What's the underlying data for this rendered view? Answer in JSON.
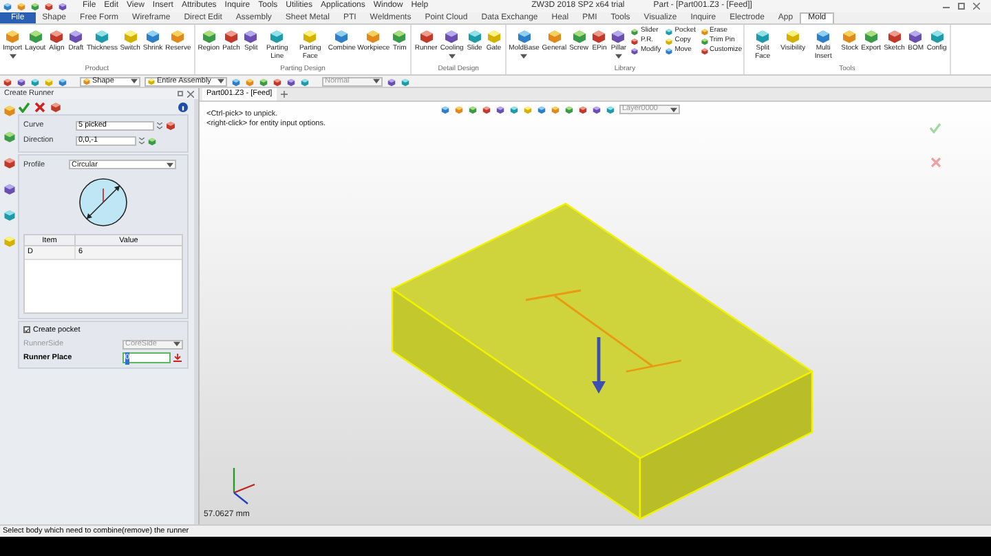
{
  "title_bar": {
    "menu": [
      "File",
      "Edit",
      "View",
      "Insert",
      "Attributes",
      "Inquire",
      "Tools",
      "Utilities",
      "Applications",
      "Window",
      "Help"
    ],
    "app_title": "ZW3D 2018 SP2 x64 trial",
    "document_title": "Part - [Part001.Z3 - [Feed]]"
  },
  "ribbon_tabs": [
    {
      "label": "File",
      "kind": "file",
      "selected": false
    },
    {
      "label": "Shape",
      "kind": "tab",
      "selected": false
    },
    {
      "label": "Free Form",
      "kind": "tab",
      "selected": false
    },
    {
      "label": "Wireframe",
      "kind": "tab",
      "selected": false
    },
    {
      "label": "Direct Edit",
      "kind": "tab",
      "selected": false
    },
    {
      "label": "Assembly",
      "kind": "tab",
      "selected": false
    },
    {
      "label": "Sheet Metal",
      "kind": "tab",
      "selected": false
    },
    {
      "label": "PTI",
      "kind": "tab",
      "selected": false
    },
    {
      "label": "Weldments",
      "kind": "tab",
      "selected": false
    },
    {
      "label": "Point Cloud",
      "kind": "tab",
      "selected": false
    },
    {
      "label": "Data Exchange",
      "kind": "tab",
      "selected": false
    },
    {
      "label": "Heal",
      "kind": "tab",
      "selected": false
    },
    {
      "label": "PMI",
      "kind": "tab",
      "selected": false
    },
    {
      "label": "Tools",
      "kind": "tab",
      "selected": false
    },
    {
      "label": "Visualize",
      "kind": "tab",
      "selected": false
    },
    {
      "label": "Inquire",
      "kind": "tab",
      "selected": false
    },
    {
      "label": "Electrode",
      "kind": "tab",
      "selected": false
    },
    {
      "label": "App",
      "kind": "tab",
      "selected": false
    },
    {
      "label": "Mold",
      "kind": "tab",
      "selected": true
    }
  ],
  "ribbon_groups": [
    {
      "title": "Product",
      "tools": [
        {
          "label": "Import",
          "dropdown": true
        },
        {
          "label": "Layout",
          "dropdown": false
        },
        {
          "label": "Align",
          "dropdown": false
        },
        {
          "label": "Draft",
          "dropdown": false
        },
        {
          "label": "Thickness",
          "dropdown": false
        },
        {
          "label": "Switch",
          "dropdown": false
        },
        {
          "label": "Shrink",
          "dropdown": false
        },
        {
          "label": "Reserve",
          "dropdown": false
        }
      ]
    },
    {
      "title": "Parting Design",
      "tools": [
        {
          "label": "Region",
          "dropdown": false
        },
        {
          "label": "Patch",
          "dropdown": false
        },
        {
          "label": "Split",
          "dropdown": false
        },
        {
          "label": "Parting Line",
          "dropdown": false
        },
        {
          "label": "Parting Face",
          "dropdown": false
        },
        {
          "label": "Combine",
          "dropdown": false
        },
        {
          "label": "Workpiece",
          "dropdown": false
        },
        {
          "label": "Trim",
          "dropdown": false
        }
      ]
    },
    {
      "title": "Detail Design",
      "tools": [
        {
          "label": "Runner",
          "dropdown": false
        },
        {
          "label": "Cooling",
          "dropdown": true
        },
        {
          "label": "Slide",
          "dropdown": false
        },
        {
          "label": "Gate",
          "dropdown": false
        }
      ]
    },
    {
      "title": "Library",
      "tools": [
        {
          "label": "MoldBase",
          "dropdown": true
        },
        {
          "label": "General",
          "dropdown": false
        },
        {
          "label": "Screw",
          "dropdown": false
        },
        {
          "label": "EPin",
          "dropdown": false
        },
        {
          "label": "Pillar",
          "dropdown": true
        }
      ],
      "small_tools": [
        "Slider",
        "P.R.",
        "Modify",
        "Pocket",
        "Copy",
        "Move",
        "Erase",
        "Trim Pin",
        "Customize"
      ]
    },
    {
      "title": "Tools",
      "tools": [
        {
          "label": "Split Face",
          "dropdown": false
        },
        {
          "label": "Visibility",
          "dropdown": false
        },
        {
          "label": "Multi Insert",
          "dropdown": false
        },
        {
          "label": "Stock",
          "dropdown": false
        },
        {
          "label": "Export",
          "dropdown": false
        },
        {
          "label": "Sketch",
          "dropdown": false
        },
        {
          "label": "BOM",
          "dropdown": false
        },
        {
          "label": "Config",
          "dropdown": false
        }
      ]
    }
  ],
  "toolbar": {
    "filter": "Shape",
    "scope": "Entire Assembly",
    "style": "Normal"
  },
  "panel": {
    "title": "Create Runner",
    "curve_label": "Curve",
    "curve": "5 picked",
    "direction_label": "Direction",
    "direction": "0,0,-1",
    "profile_label": "Profile",
    "profile": "Circular",
    "table": {
      "columns": [
        "Item",
        "Value"
      ],
      "rows": [
        [
          "D",
          "6"
        ]
      ]
    },
    "create_pocket": {
      "label": "Create pocket",
      "checked": true
    },
    "runner_side": {
      "label": "RunnerSide",
      "value": "CoreSide",
      "disabled": true
    },
    "runner_place": {
      "label": "Runner Place",
      "value": "0"
    }
  },
  "viewport": {
    "tab": "Part001.Z3 - [Feed]",
    "hints": [
      "<Ctrl-pick> to unpick.",
      "<right-click> for entity input options."
    ],
    "layer": "Layer0000",
    "measure": "57.0627 mm"
  },
  "status_bar": "Select body which need to combine(remove) the runner"
}
